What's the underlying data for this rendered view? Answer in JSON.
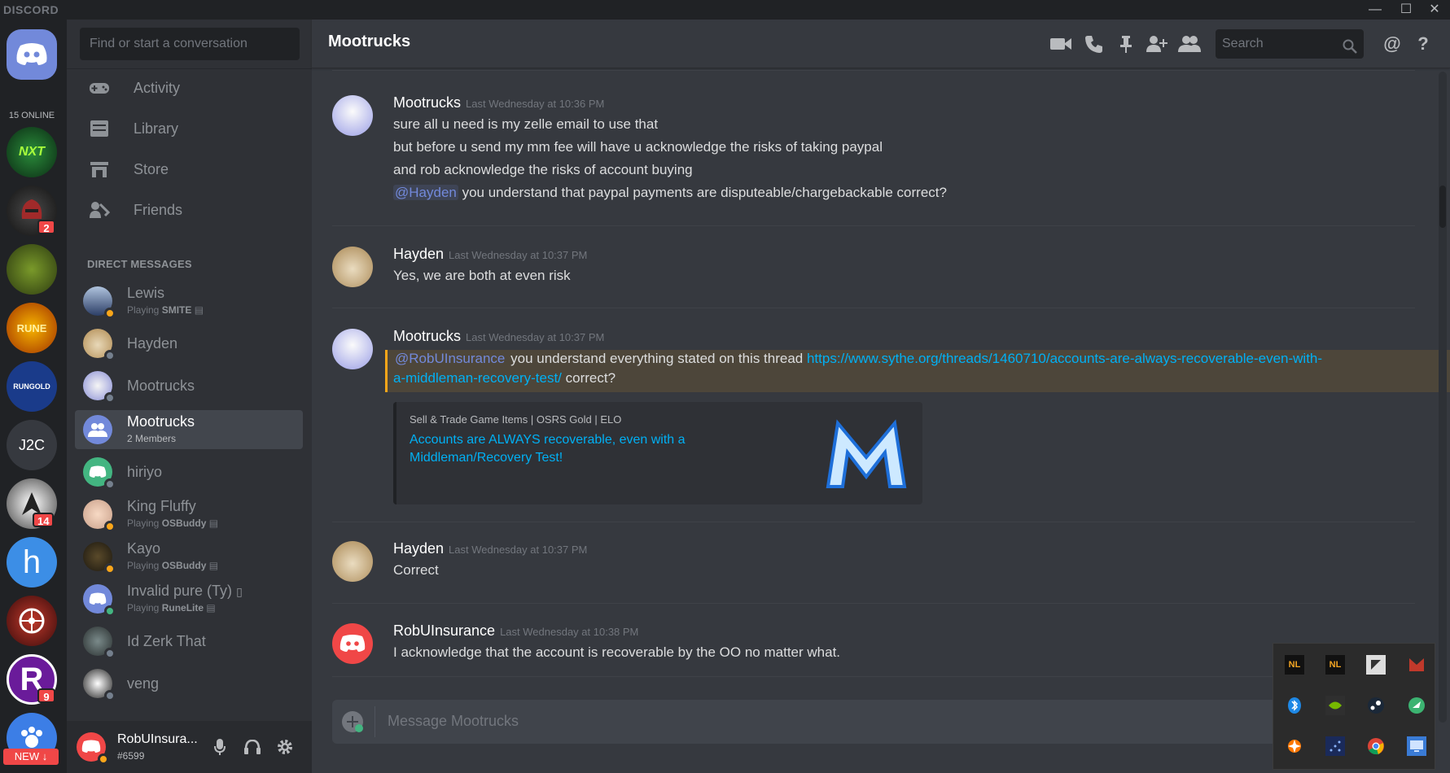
{
  "window": {
    "brand": "DISCORD",
    "minimize": "—",
    "maximize": "☐",
    "close": "✕"
  },
  "guilds": {
    "online_count": "15 ONLINE",
    "items": [
      {
        "name": "home",
        "label": ""
      },
      {
        "name": "next-level",
        "label": "NEXT LEVEL"
      },
      {
        "name": "residence",
        "label": "",
        "badge": "2"
      },
      {
        "name": "green-server",
        "label": ""
      },
      {
        "name": "rune-treasure",
        "label": "RUNE"
      },
      {
        "name": "rungold",
        "label": "RUNGOLD"
      },
      {
        "name": "j2c",
        "label": "J2C"
      },
      {
        "name": "alpha-server",
        "label": "",
        "badge": "14"
      },
      {
        "name": "h-server",
        "label": "h"
      },
      {
        "name": "red-wheel-server",
        "label": ""
      },
      {
        "name": "r-server",
        "label": "R",
        "badge": "9"
      },
      {
        "name": "paw-server",
        "label": ""
      }
    ],
    "new_label": "NEW"
  },
  "sidebar": {
    "search_placeholder": "Find or start a conversation",
    "nav": [
      {
        "label": "Activity",
        "icon": "gamepad-icon"
      },
      {
        "label": "Library",
        "icon": "library-icon"
      },
      {
        "label": "Store",
        "icon": "store-icon"
      },
      {
        "label": "Friends",
        "icon": "friends-icon"
      }
    ],
    "dm_header": "DIRECT MESSAGES",
    "dms": [
      {
        "name": "Lewis",
        "sub_prefix": "Playing ",
        "sub_game": "SMITE",
        "status": "idle"
      },
      {
        "name": "Hayden",
        "status": "offline"
      },
      {
        "name": "Mootrucks",
        "status": "offline"
      },
      {
        "name": "Mootrucks",
        "sub_prefix": "2 Members",
        "sub_game": "",
        "status": "group",
        "active": true
      },
      {
        "name": "hiriyo",
        "status": "offline"
      },
      {
        "name": "King Fluffy",
        "sub_prefix": "Playing ",
        "sub_game": "OSBuddy",
        "status": "idle"
      },
      {
        "name": "Kayo",
        "sub_prefix": "Playing ",
        "sub_game": "OSBuddy",
        "status": "idle"
      },
      {
        "name": "Invalid pure (Ty)",
        "sub_prefix": "Playing ",
        "sub_game": "RuneLite",
        "status": "online"
      },
      {
        "name": "Id Zerk That",
        "status": "offline"
      },
      {
        "name": "veng",
        "status": "offline"
      }
    ],
    "user": {
      "name": "RobUInsura...",
      "tag": "#6599"
    }
  },
  "header": {
    "title": "Mootrucks",
    "search_placeholder": "Search"
  },
  "messages": [
    {
      "author": "Mootrucks",
      "timestamp": "Last Wednesday at 10:36 PM",
      "lines": [
        "sure all u need is my zelle email to use that",
        "but before u send my mm fee will have u acknowledge the risks of taking paypal",
        "and rob acknowledge the risks of account buying"
      ],
      "mention_line": {
        "mention": "@Hayden",
        "text": " you understand that paypal payments are disputeable/chargebackable correct?"
      }
    },
    {
      "author": "Hayden",
      "timestamp": "Last Wednesday at 10:37 PM",
      "lines": [
        "Yes, we are both at even risk"
      ]
    },
    {
      "author": "Mootrucks",
      "timestamp": "Last Wednesday at 10:37 PM",
      "mention": "@RobUInsurance",
      "text_before_link": " you understand everything stated on this thread ",
      "link_part1": "https://www.sythe.org/threads/1460710/accounts-are-always-recoverable-even-with-",
      "link_part2": "a-middleman-recovery-test/",
      "text_after_link": " correct?",
      "embed": {
        "provider": "Sell & Trade Game Items | OSRS Gold | ELO",
        "title": "Accounts are ALWAYS recoverable, even with a Middleman/Recovery Test!"
      }
    },
    {
      "author": "Hayden",
      "timestamp": "Last Wednesday at 10:37 PM",
      "lines": [
        "Correct"
      ]
    },
    {
      "author": "RobUInsurance",
      "timestamp": "Last Wednesday at 10:38 PM",
      "lines": [
        "I acknowledge that the account is recoverable by the OO no matter what."
      ]
    }
  ],
  "composer": {
    "placeholder": "Message Mootrucks"
  },
  "colors": {
    "accent": "#7289da",
    "link": "#00b0f4",
    "mention_highlight": "#faa61a",
    "badge": "#f04747",
    "online": "#43b581",
    "idle": "#faa61a",
    "offline": "#747f8d"
  }
}
